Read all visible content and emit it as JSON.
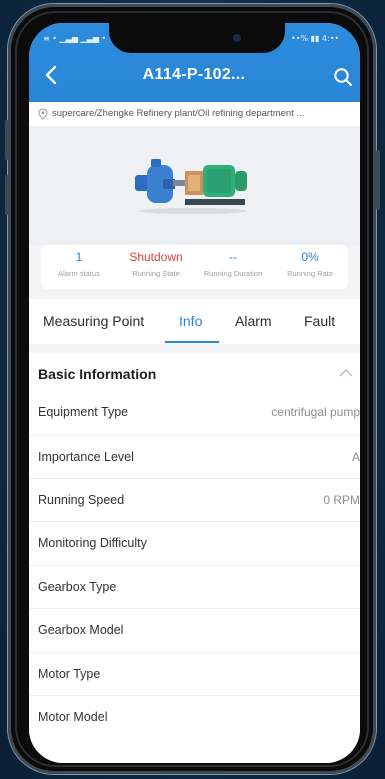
{
  "status_bar": {
    "left": "≡ • ▁▃▅ ▁▃▅ •",
    "right": "••% ▮▮ 4:••"
  },
  "header": {
    "title": "A114-P-102..."
  },
  "breadcrumb": {
    "path": "supercare/Zhengke Refinery plant/Oil refining department ..."
  },
  "stats": [
    {
      "value": "1",
      "label": "Alarm status",
      "color": "#2a86d6"
    },
    {
      "value": "Shutdown",
      "label": "Running State",
      "color": "#d9453b"
    },
    {
      "value": "--",
      "label": "Running Duration",
      "color": "#2a86d6"
    },
    {
      "value": "0%",
      "label": "Running Rate",
      "color": "#2a86d6"
    }
  ],
  "tabs": [
    {
      "label": "Measuring Point",
      "active": false
    },
    {
      "label": "Info",
      "active": true
    },
    {
      "label": "Alarm",
      "active": false
    },
    {
      "label": "Fault",
      "active": false
    }
  ],
  "basic_info": {
    "heading": "Basic Information",
    "rows": [
      {
        "key": "Equipment Type",
        "value": "centrifugal pump"
      },
      {
        "key": "Importance Level",
        "value": "A"
      },
      {
        "key": "Running Speed",
        "value": "0 RPM"
      },
      {
        "key": "Monitoring Difficulty",
        "value": ""
      },
      {
        "key": "Gearbox Type",
        "value": ""
      },
      {
        "key": "Gearbox Model",
        "value": ""
      },
      {
        "key": "Motor Type",
        "value": ""
      },
      {
        "key": "Motor Model",
        "value": ""
      }
    ]
  },
  "colors": {
    "accent": "#2a86d6",
    "alarm_red": "#d9453b",
    "pump_blue": "#3b7fd0",
    "motor_green": "#2fae7a"
  },
  "icons": {
    "back": "chevron-left-icon",
    "search": "search-icon",
    "location": "location-pin-icon",
    "collapse": "chevron-up-icon"
  }
}
